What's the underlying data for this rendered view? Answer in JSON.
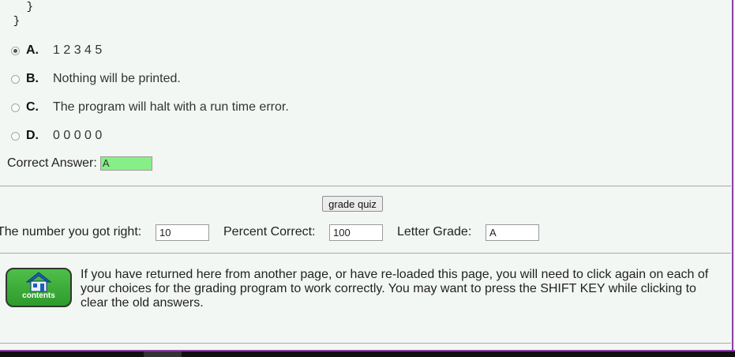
{
  "code_lines": [
    "    }",
    "  }"
  ],
  "options": [
    {
      "letter": "A.",
      "text": "1 2 3 4 5",
      "selected": true
    },
    {
      "letter": "B.",
      "text": "Nothing will be printed.",
      "selected": false
    },
    {
      "letter": "C.",
      "text": "The program will halt with a run time error.",
      "selected": false
    },
    {
      "letter": "D.",
      "text": "0 0 0 0 0",
      "selected": false
    }
  ],
  "correct_answer": {
    "label": "Correct Answer:",
    "value": "A",
    "color": "#86f086"
  },
  "grade_button": {
    "label": "grade quiz"
  },
  "score": {
    "right_label": "The number you got right:",
    "right_value": "10",
    "percent_label": "Percent Correct:",
    "percent_value": "100",
    "letter_label": "Letter Grade:",
    "letter_value": "A"
  },
  "contents_button": {
    "label": "contents",
    "icon": "house-icon",
    "color": "#3aa836"
  },
  "notice": "If you have returned here from another page, or have re-loaded this page, you will need to click again on each of your choices for the grading program to work correctly. You may want to press the SHIFT KEY while clicking to clear the old answers.",
  "accent_color": "#8b3fa8"
}
